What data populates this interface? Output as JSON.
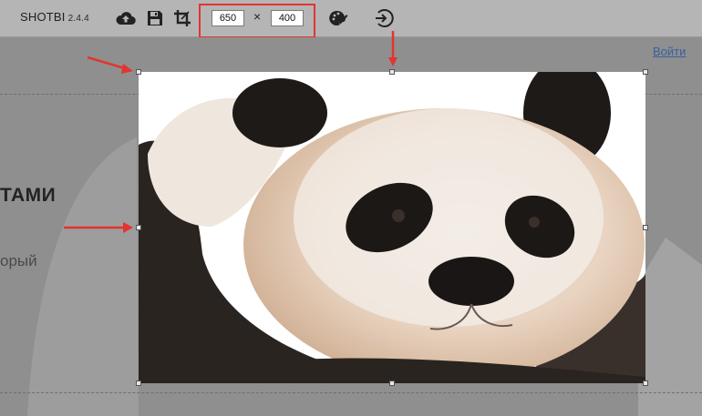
{
  "toolbar": {
    "brand": "SHOTBI",
    "version": "2.4.4",
    "icons": [
      "upload-cloud-icon",
      "save-icon",
      "crop-icon",
      "editor-brush-icon",
      "exit-icon"
    ],
    "width_value": "650",
    "times_symbol": "×",
    "height_value": "400"
  },
  "page": {
    "login_link": "Войти",
    "heading_fragment": "ТАМИ",
    "subtext_fragment": "орый"
  },
  "colors": {
    "highlight_red": "#e3342f",
    "toolbar_bg": "#b5b5b5",
    "dim_overlay": "#8f8f8f"
  }
}
